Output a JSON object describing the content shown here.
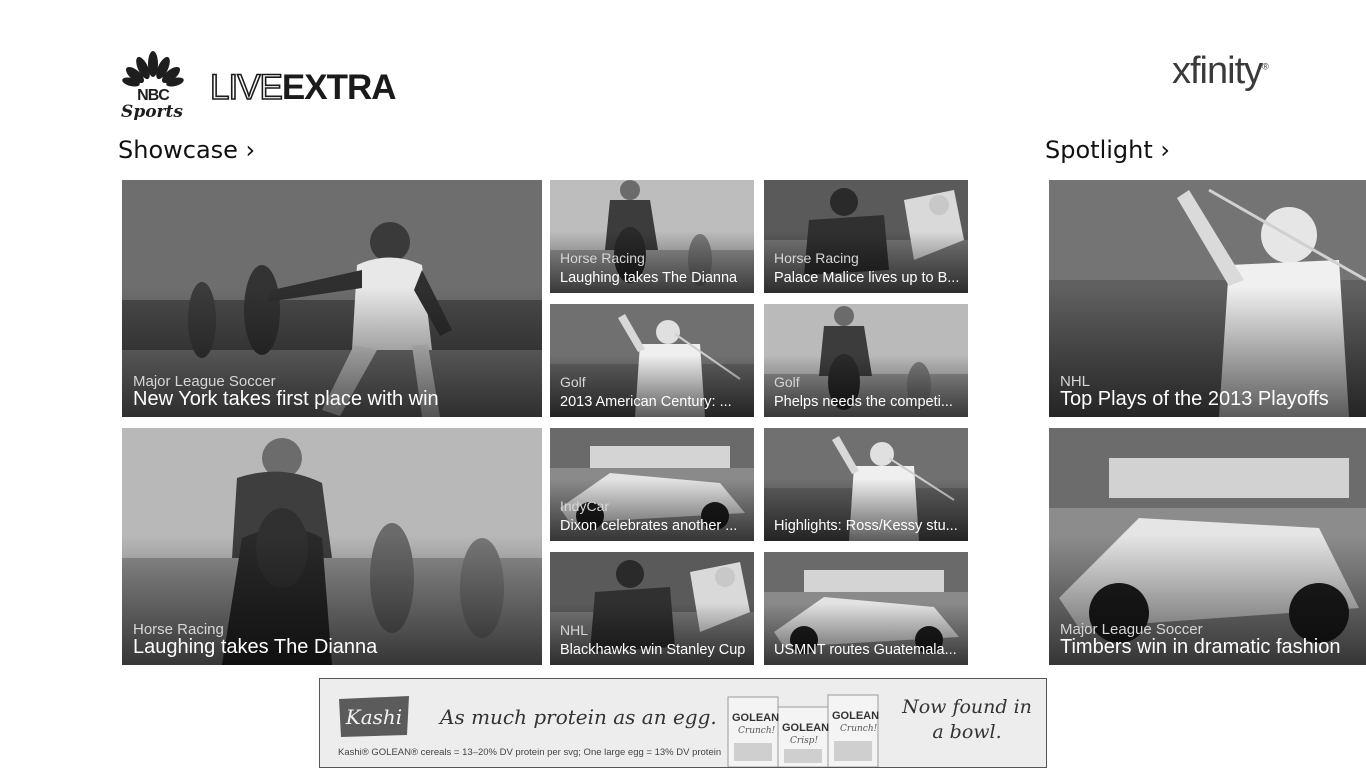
{
  "header": {
    "brand_top": "NBC",
    "brand_bottom": "Sports",
    "app_name_live": "LIVE",
    "app_name_extra": "EXTRA",
    "provider": "xfinity",
    "provider_mark": "®"
  },
  "sections": {
    "showcase_title": "Showcase ›",
    "spotlight_title": "Spotlight ›"
  },
  "showcase": {
    "feature_1": {
      "category": "Major League Soccer",
      "title": "New York takes first place with win"
    },
    "feature_2": {
      "category": "Horse Racing",
      "title": "Laughing takes The Dianna"
    },
    "tiles": [
      {
        "category": "Horse Racing",
        "title": "Laughing takes The Dianna"
      },
      {
        "category": "Horse Racing",
        "title": "Palace Malice lives up to B..."
      },
      {
        "category": "Golf",
        "title": "2013 American Century: ..."
      },
      {
        "category": "Golf",
        "title": "Phelps needs the competi..."
      },
      {
        "category": "IndyCar",
        "title": "Dixon celebrates another ..."
      },
      {
        "category": "",
        "title": "Highlights: Ross/Kessy stu..."
      },
      {
        "category": "NHL",
        "title": "Blackhawks win Stanley Cup"
      },
      {
        "category": "",
        "title": "USMNT routes Guatemala..."
      }
    ]
  },
  "spotlight": {
    "items": [
      {
        "category": "NHL",
        "title": "Top Plays of the 2013 Playoffs"
      },
      {
        "category": "Major League Soccer",
        "title": "Timbers win in dramatic fashion"
      }
    ]
  },
  "ad": {
    "brand": "Kashi",
    "tagline": "As much protein as an egg.",
    "fine_print": "Kashi® GOLEAN® cereals = 13–20% DV protein per svg; One large egg = 13% DV protein",
    "box_labels": [
      "GOLEAN",
      "GOLEAN",
      "GOLEAN"
    ],
    "box_sublabels": [
      "Crunch!",
      "Crisp!",
      "Crunch!"
    ],
    "closing_line_1": "Now found in",
    "closing_line_2": "a bowl."
  }
}
